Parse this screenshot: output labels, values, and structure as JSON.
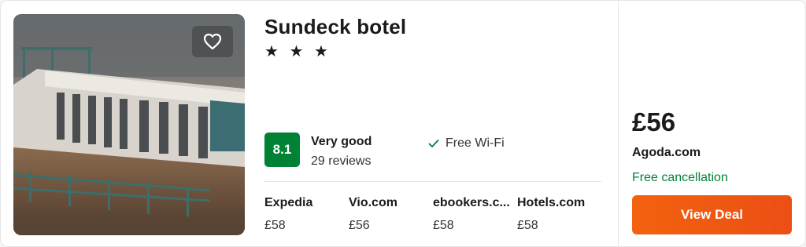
{
  "hotel": {
    "name": "Sundeck botel",
    "stars": "★ ★ ★",
    "favorite_icon": "heart-icon",
    "rating": {
      "score": "8.1",
      "label": "Very good",
      "reviews": "29 reviews",
      "badge_color": "#008234"
    },
    "amenities": [
      {
        "icon": "check-icon",
        "label": "Free Wi-Fi"
      }
    ]
  },
  "providers": [
    {
      "name": "Expedia",
      "price": "£58"
    },
    {
      "name": "Vio.com",
      "price": "£56"
    },
    {
      "name": "ebookers.c...",
      "price": "£58"
    },
    {
      "name": "Hotels.com",
      "price": "£58"
    }
  ],
  "deal": {
    "price": "£56",
    "provider": "Agoda.com",
    "cancellation": "Free cancellation",
    "button_label": "View Deal",
    "button_color": "#f0590f"
  }
}
